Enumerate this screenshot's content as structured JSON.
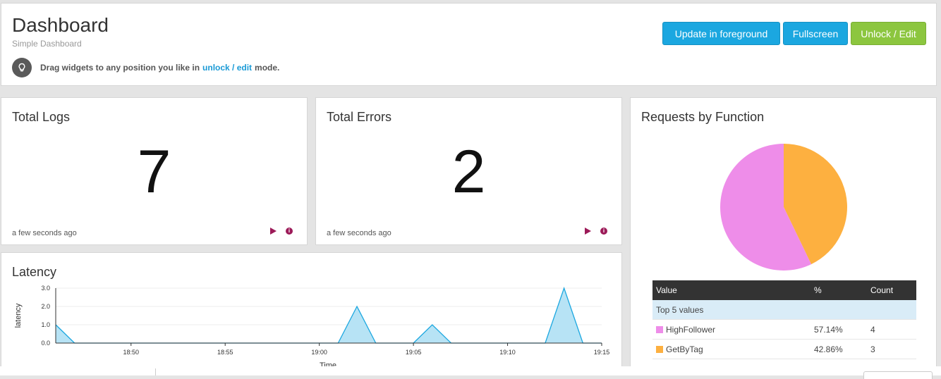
{
  "header": {
    "title": "Dashboard",
    "subtitle": "Simple Dashboard",
    "hint_prefix": "Drag widgets to any position you like in",
    "hint_link": "unlock / edit",
    "hint_suffix": "mode.",
    "buttons": {
      "update": "Update in foreground",
      "fullscreen": "Fullscreen",
      "unlock": "Unlock / Edit"
    }
  },
  "widgets": {
    "total_logs": {
      "title": "Total Logs",
      "value": "7",
      "time": "a few seconds ago"
    },
    "total_errors": {
      "title": "Total Errors",
      "value": "2",
      "time": "a few seconds ago"
    },
    "latency": {
      "title": "Latency"
    },
    "requests": {
      "title": "Requests by Function",
      "table": {
        "headers": [
          "Value",
          "%",
          "Count"
        ],
        "top_label": "Top 5 values",
        "rows": [
          {
            "value": "HighFollower",
            "percent": "57.14%",
            "count": "4",
            "color": "#ee8de9"
          },
          {
            "value": "GetByTag",
            "percent": "42.86%",
            "count": "3",
            "color": "#fdb040"
          }
        ]
      }
    }
  },
  "colors": {
    "accent_blue": "#1ba7e0",
    "accent_green": "#8cc63f",
    "icon_red": "#9c1a58",
    "line_blue": "#1ba7e0"
  },
  "chart_data": [
    {
      "type": "area",
      "title": "Latency",
      "xlabel": "Time",
      "ylabel": "latency",
      "x_ticks": [
        "18:50",
        "18:55",
        "19:00",
        "19:05",
        "19:10",
        "19:15"
      ],
      "y_ticks": [
        "0.0",
        "1.0",
        "2.0",
        "3.0"
      ],
      "x": [
        "18:46",
        "18:47",
        "19:01",
        "19:02",
        "19:03",
        "19:05",
        "19:06",
        "19:07",
        "19:12",
        "19:13",
        "19:14",
        "19:15"
      ],
      "values": [
        1,
        0,
        0,
        2,
        0,
        0,
        1,
        0,
        0,
        3,
        0,
        0
      ],
      "ylim": [
        0,
        3
      ],
      "grid": true
    },
    {
      "type": "pie",
      "title": "Requests by Function",
      "categories": [
        "HighFollower",
        "GetByTag"
      ],
      "values": [
        57.14,
        42.86
      ]
    }
  ]
}
